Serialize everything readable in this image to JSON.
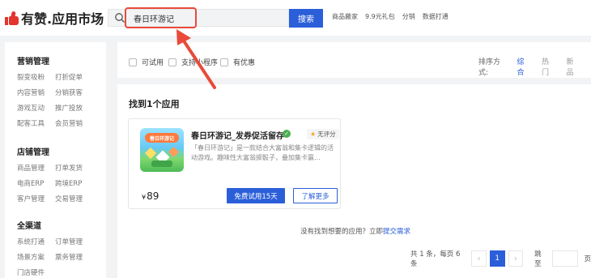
{
  "header": {
    "logo_text": "有赞.应用市场",
    "search_value": "春日环游记",
    "search_button": "搜索",
    "hot_links": [
      "商品搬家",
      "9.9元礼包",
      "分销",
      "数据打通"
    ]
  },
  "sidebar": {
    "groups": [
      {
        "title": "营销管理",
        "items": [
          "裂变吸粉",
          "打折促单",
          "内容营销",
          "分销获客",
          "游戏互动",
          "推广投放",
          "配客工具",
          "会员营销"
        ]
      },
      {
        "title": "店铺管理",
        "items": [
          "商品管理",
          "打单发货",
          "电商ERP",
          "跨境ERP",
          "客户管理",
          "交易管理"
        ]
      },
      {
        "title": "全渠道",
        "items": [
          "系统打通",
          "订单管理",
          "场景方案",
          "票务管理",
          "门店硬件"
        ]
      }
    ]
  },
  "filters": {
    "options": [
      "可试用",
      "支持小程序",
      "有优惠"
    ],
    "sort_label": "排序方式:",
    "sort_options": [
      "综合",
      "热门",
      "新品"
    ],
    "sort_active": "综合"
  },
  "results": {
    "title": "找到1个应用",
    "app": {
      "name": "春日环游记_发券促活留存",
      "icon_banner": "春日环游记",
      "verified_icon": "verified-icon",
      "rating": "无评分",
      "description": "「春日环游记」是一款结合大富翁和集卡逻辑的活动游戏。趣味性大富翁掷骰子，叠加集卡赢...",
      "currency": "¥",
      "price": "89",
      "trial_button": "免费试用15天",
      "more_button": "了解更多"
    },
    "not_found_text": "没有找到想要的应用？立即",
    "not_found_link": "提交需求"
  },
  "pagination": {
    "summary": "共 1 条，每页 6 条",
    "prev": "‹",
    "current_page": "1",
    "next": "›",
    "jump_label": "跳至",
    "page_suffix": "页"
  },
  "colors": {
    "accent": "#2b5fd9",
    "highlight": "#e94a3a",
    "logo": "#e3342f"
  }
}
